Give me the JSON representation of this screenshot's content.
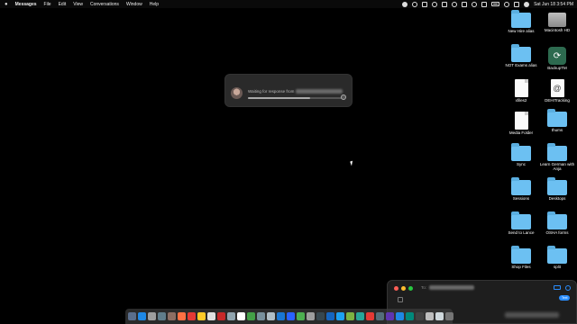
{
  "menubar": {
    "app_name": "Messages",
    "menus": [
      "File",
      "Edit",
      "View",
      "Conversations",
      "Window",
      "Help"
    ],
    "clock": "Sat Jun 18  3:54 PM"
  },
  "notification": {
    "text": "Waiting for response from",
    "progress": 0.65
  },
  "desktop": {
    "icons": [
      {
        "label": "New Hire alias",
        "kind": "folder"
      },
      {
        "label": "Macintosh HD",
        "kind": "drive"
      },
      {
        "label": "NOT Exams alias",
        "kind": "folder"
      },
      {
        "label": "BackupTM",
        "kind": "backup"
      },
      {
        "label": "xfiles2",
        "kind": "doc"
      },
      {
        "label": "DEHITracking",
        "kind": "contact"
      },
      {
        "label": "Media Folder",
        "kind": "doc"
      },
      {
        "label": "thums",
        "kind": "folder"
      },
      {
        "label": "Sync",
        "kind": "folder"
      },
      {
        "label": "Learn German with Anja",
        "kind": "folder"
      },
      {
        "label": "Sessions",
        "kind": "folder"
      },
      {
        "label": "Desktops",
        "kind": "folder"
      },
      {
        "label": "Send to Lance",
        "kind": "folder"
      },
      {
        "label": "OSHA forms",
        "kind": "folder"
      },
      {
        "label": "Shop Files",
        "kind": "folder"
      },
      {
        "label": "split",
        "kind": "folder"
      }
    ]
  },
  "messages_window": {
    "to_label": "To:",
    "bubble": "Text"
  },
  "dock": {
    "app_colors": [
      "#5a6e8c",
      "#1e88e5",
      "#9e9e9e",
      "#607d8b",
      "#8d6e63",
      "#ff7043",
      "#e53935",
      "#ffca28",
      "#e0e0e0",
      "#c62828",
      "#90a4ae",
      "#ffffff",
      "#43a047",
      "#78909c",
      "#b0bec5",
      "#1976d2",
      "#2962ff",
      "#4caf50",
      "#9e9e9e",
      "#37474f",
      "#1565c0",
      "#1da1f2",
      "#7cb342",
      "#26a69a",
      "#e53935",
      "#546e7a",
      "#5e35b1",
      "#1e88e5",
      "#00897b",
      "#424242",
      "#bdbdbd",
      "#cfd8dc",
      "#757575"
    ]
  }
}
